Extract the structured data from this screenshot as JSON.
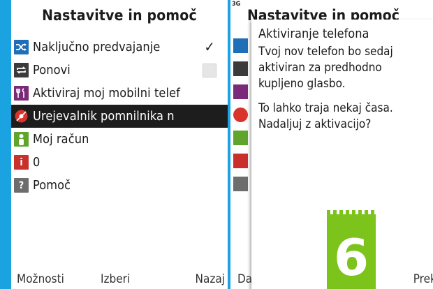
{
  "left_screen": {
    "title": "Nastavitve in pomoč",
    "menu": [
      {
        "label": "Naključno predvajanje",
        "icon": "shuffle-icon",
        "checked": true
      },
      {
        "label": "Ponovi",
        "icon": "repeat-icon",
        "checked": false
      },
      {
        "label": "Aktiviraj moj mobilni telef",
        "icon": "tools-icon"
      },
      {
        "label": "Urejevalnik pomnilnika n",
        "icon": "memory-editor-icon",
        "selected": true
      },
      {
        "label": "Moj račun",
        "icon": "account-icon"
      },
      {
        "label": "0",
        "icon": "info-icon"
      },
      {
        "label": "Pomoč",
        "icon": "help-icon"
      }
    ],
    "softkeys": {
      "left": "Možnosti",
      "middle": "Izberi",
      "right": "Nazaj"
    },
    "check_mark": "✓"
  },
  "right_screen": {
    "signal": "3G",
    "background_title": "Nastavitve in pomoč",
    "dialog": {
      "title": "Aktiviranje telefona",
      "paragraph1": "Tvoj nov telefon bo sedaj\naktiviran za predhodno\nkupljeno glasbo.",
      "paragraph2": "To lahko traja nekaj časa.\nNadaljuj z aktivacijo?"
    },
    "softkeys": {
      "left": "Da",
      "right": "Prekliči"
    }
  },
  "badge": {
    "number": "6"
  },
  "colors": {
    "background": "#1aa3e0",
    "selected_row": "#1d1d1d",
    "badge": "#7cc41c",
    "shuffle_icon": "#1e6fb8",
    "repeat_icon": "#3b3b3b",
    "tools_icon": "#7a2a78",
    "memory_icon": "#d9342b",
    "account_icon": "#5fa52c",
    "info_icon": "#c9302c",
    "help_icon": "#6d6d6d"
  }
}
